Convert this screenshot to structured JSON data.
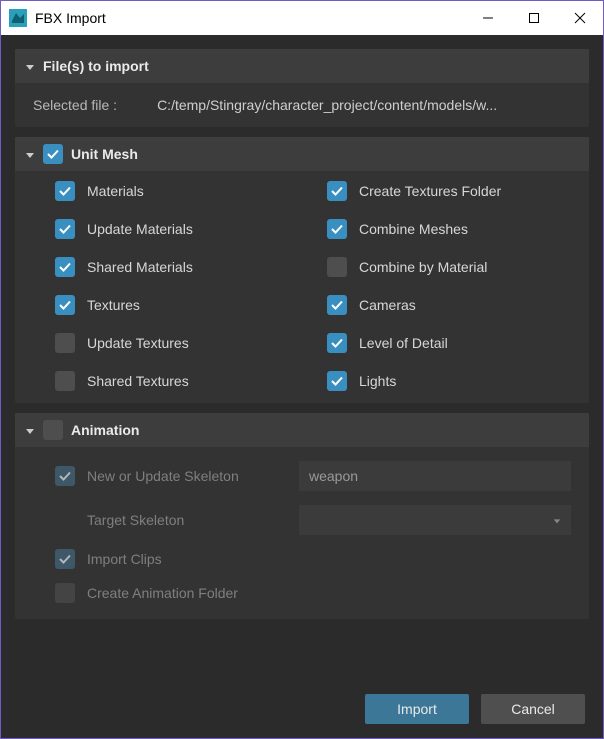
{
  "window": {
    "title": "FBX Import"
  },
  "files_section": {
    "header": "File(s) to import",
    "selected_label": "Selected file :",
    "selected_value": "C:/temp/Stingray/character_project/content/models/w..."
  },
  "unit_mesh": {
    "header": "Unit Mesh",
    "checked": true,
    "options_left": [
      {
        "label": "Materials",
        "checked": true
      },
      {
        "label": "Update Materials",
        "checked": true
      },
      {
        "label": "Shared Materials",
        "checked": true
      },
      {
        "label": "Textures",
        "checked": true
      },
      {
        "label": "Update Textures",
        "checked": false
      },
      {
        "label": "Shared Textures",
        "checked": false
      }
    ],
    "options_right": [
      {
        "label": "Create Textures Folder",
        "checked": true
      },
      {
        "label": "Combine Meshes",
        "checked": true
      },
      {
        "label": "Combine by Material",
        "checked": false
      },
      {
        "label": "Cameras",
        "checked": true
      },
      {
        "label": "Level of Detail",
        "checked": true
      },
      {
        "label": "Lights",
        "checked": true
      }
    ]
  },
  "animation": {
    "header": "Animation",
    "checked": false,
    "skeleton_label": "New or Update Skeleton",
    "skeleton_value": "weapon",
    "target_label": "Target Skeleton",
    "target_value": "",
    "import_clips_label": "Import Clips",
    "import_clips_checked": true,
    "create_folder_label": "Create Animation Folder",
    "create_folder_checked": false
  },
  "buttons": {
    "import": "Import",
    "cancel": "Cancel"
  }
}
